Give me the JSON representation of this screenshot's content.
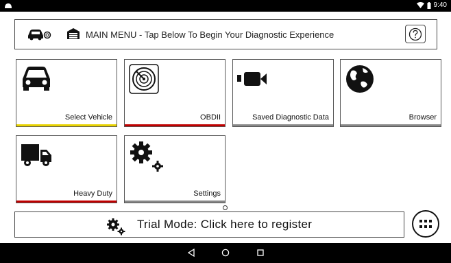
{
  "status": {
    "time": "9:40",
    "left_icon": "android-icon",
    "wifi_icon": "wifi-icon",
    "battery_icon": "battery-icon"
  },
  "header": {
    "title": "MAIN MENU - Tap Below To Begin Your Diagnostic Experience",
    "help_icon": "help-icon"
  },
  "tiles": [
    {
      "label": "Select Vehicle",
      "icon": "car-icon",
      "accent": "#e8d200"
    },
    {
      "label": "OBDII",
      "icon": "radar-icon",
      "accent": "#c00000"
    },
    {
      "label": "Saved Diagnostic Data",
      "icon": "video-camera-icon",
      "accent": "#888888"
    },
    {
      "label": "Browser",
      "icon": "globe-icon",
      "accent": "#888888"
    },
    {
      "label": "Heavy Duty",
      "icon": "truck-icon",
      "accent": "#c00000"
    },
    {
      "label": "Settings",
      "icon": "gears-icon",
      "accent": "#888888"
    }
  ],
  "trial": {
    "text": "Trial Mode: Click here to register"
  },
  "apps_icon": "app-grid-icon",
  "navbar": {
    "back": "back-icon",
    "home": "home-icon",
    "recents": "recents-icon"
  }
}
